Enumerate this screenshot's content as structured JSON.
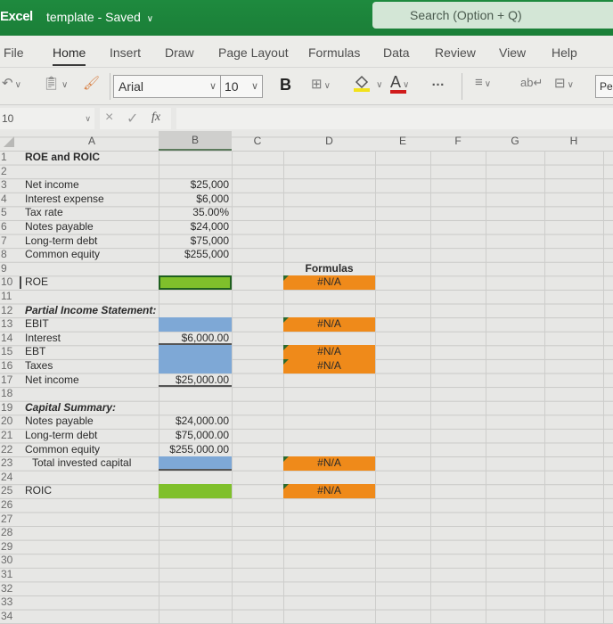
{
  "titlebar": {
    "app_name": "Excel",
    "doc_title": "template",
    "separator": "-",
    "save_status": "Saved",
    "search_placeholder": "Search (Option + Q)"
  },
  "tabs": [
    {
      "label": "File"
    },
    {
      "label": "Home",
      "active": true
    },
    {
      "label": "Insert"
    },
    {
      "label": "Draw"
    },
    {
      "label": "Page Layout"
    },
    {
      "label": "Formulas"
    },
    {
      "label": "Data"
    },
    {
      "label": "Review"
    },
    {
      "label": "View"
    },
    {
      "label": "Help"
    }
  ],
  "toolbar": {
    "undo_icon": "undo-icon",
    "paste_icon": "clipboard-icon",
    "format_painter_icon": "format-painter-icon",
    "font_name": "Arial",
    "font_size": "10",
    "bold_label": "B",
    "borders_icon": "borders-icon",
    "fill_color": "#f2e21a",
    "font_color": "#d01b1b",
    "font_color_label": "A",
    "more_label": "…",
    "align_icon": "align-icon",
    "wrap_icon": "wrap-text-icon",
    "merge_icon": "merge-icon",
    "style_box": "Pe"
  },
  "formula_bar": {
    "name_box": "10",
    "cancel_label": "×",
    "enter_label": "✓",
    "fx_label": "fx",
    "formula": ""
  },
  "columns": [
    "A",
    "B",
    "C",
    "D",
    "E",
    "F",
    "G",
    "H"
  ],
  "selected_column": "B",
  "rows": [
    {
      "n": "1",
      "a": "ROE and ROIC",
      "a_style": "bold"
    },
    {
      "n": "2"
    },
    {
      "n": "3",
      "a": "Net income",
      "b": "$25,000"
    },
    {
      "n": "4",
      "a": "Interest expense",
      "b": "$6,000"
    },
    {
      "n": "5",
      "a": "Tax rate",
      "b": "35.00%"
    },
    {
      "n": "6",
      "a": "Notes payable",
      "b": "$24,000"
    },
    {
      "n": "7",
      "a": "Long-term debt",
      "b": "$75,000"
    },
    {
      "n": "8",
      "a": "Common equity",
      "b": "$255,000"
    },
    {
      "n": "9",
      "d": "Formulas",
      "d_style": "label"
    },
    {
      "n": "10",
      "a": "ROE",
      "b_fill": "green",
      "b_selected": true,
      "d": "#N/A",
      "d_style": "orange",
      "active_row": true
    },
    {
      "n": "11"
    },
    {
      "n": "12",
      "a": "Partial Income Statement:",
      "a_style": "bi"
    },
    {
      "n": "13",
      "a": "EBIT",
      "b_fill": "blue",
      "d": "#N/A",
      "d_style": "orange"
    },
    {
      "n": "14",
      "a": "Interest",
      "b": "$6,000.00",
      "b_underline": true
    },
    {
      "n": "15",
      "a": "EBT",
      "b_fill": "blue",
      "d": "#N/A",
      "d_style": "orange"
    },
    {
      "n": "16",
      "a": "Taxes",
      "b_fill": "blue",
      "d": "#N/A",
      "d_style": "orange"
    },
    {
      "n": "17",
      "a": "Net income",
      "b": "$25,000.00",
      "b_underline": true
    },
    {
      "n": "18"
    },
    {
      "n": "19",
      "a": "Capital Summary:",
      "a_style": "bi"
    },
    {
      "n": "20",
      "a": "Notes payable",
      "b": "$24,000.00"
    },
    {
      "n": "21",
      "a": "Long-term debt",
      "b": "$75,000.00"
    },
    {
      "n": "22",
      "a": "Common equity",
      "b": "$255,000.00"
    },
    {
      "n": "23",
      "a": "Total invested capital",
      "a_style": "indent",
      "b_fill": "blue",
      "b_underline": true,
      "d": "#N/A",
      "d_style": "orange"
    },
    {
      "n": "24"
    },
    {
      "n": "25",
      "a": "ROIC",
      "b_fill": "green",
      "d": "#N/A",
      "d_style": "orange"
    },
    {
      "n": "26"
    },
    {
      "n": "27"
    },
    {
      "n": "28"
    },
    {
      "n": "29"
    },
    {
      "n": "30"
    },
    {
      "n": "31"
    },
    {
      "n": "32"
    },
    {
      "n": "33"
    },
    {
      "n": "34"
    }
  ],
  "colors": {
    "title_bar": "#1e8a3e",
    "input_blue": "#7ea8d6",
    "output_green": "#7fc02b",
    "formula_orange": "#ef8a1a"
  }
}
